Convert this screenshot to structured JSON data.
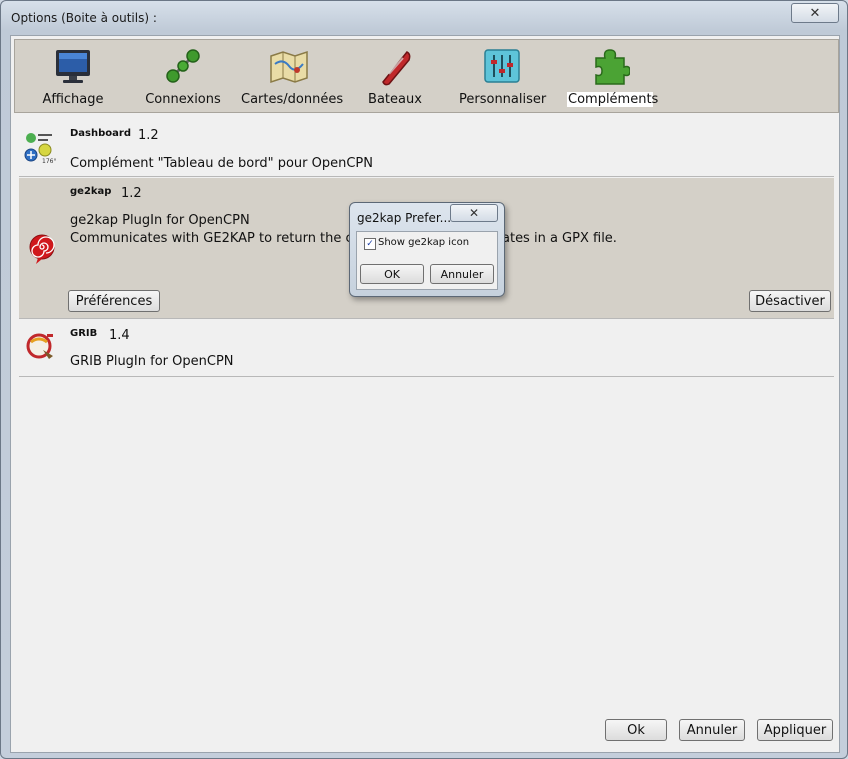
{
  "window": {
    "title": "Options (Boite à outils) :",
    "close_glyph": "✕"
  },
  "toolbar": {
    "items": [
      {
        "label": "Affichage",
        "icon": "monitor-icon"
      },
      {
        "label": "Connexions",
        "icon": "connections-icon"
      },
      {
        "label": "Cartes/données",
        "icon": "charts-icon"
      },
      {
        "label": "Bateaux",
        "icon": "boat-icon"
      },
      {
        "label": "Personnaliser",
        "icon": "sliders-icon"
      },
      {
        "label": "Compléments",
        "icon": "puzzle-icon",
        "active": true
      }
    ]
  },
  "plugins": [
    {
      "name": "Dashboard",
      "version": "1.2",
      "description": "Complément \"Tableau de bord\" pour OpenCPN",
      "icon": "dashboard-icon"
    },
    {
      "name": "ge2kap",
      "version": "1.2",
      "description_line1": "ge2kap PlugIn for OpenCPN",
      "description_line2_left": "Communicates with GE2KAP to return the curr",
      "description_line2_right": "ates in a GPX file.",
      "icon": "ge2kap-spiral-icon",
      "preferences_label": "Préférences",
      "disable_label": "Désactiver",
      "selected": true
    },
    {
      "name": "GRIB",
      "version": "1.4",
      "description": "GRIB PlugIn for OpenCPN",
      "icon": "grib-icon"
    }
  ],
  "footer": {
    "ok_label": "Ok",
    "cancel_label": "Annuler",
    "apply_label": "Appliquer"
  },
  "dialog": {
    "title": "ge2kap Prefer...",
    "close_glyph": "✕",
    "checkbox_label": "Show ge2kap icon",
    "checkbox_checked": true,
    "check_glyph": "✓",
    "ok_label": "OK",
    "cancel_label": "Annuler"
  },
  "colors": {
    "selected_row": "#d4d0c8",
    "toolbar_bg": "#d4d0c8",
    "client_bg": "#f0f0f0"
  }
}
